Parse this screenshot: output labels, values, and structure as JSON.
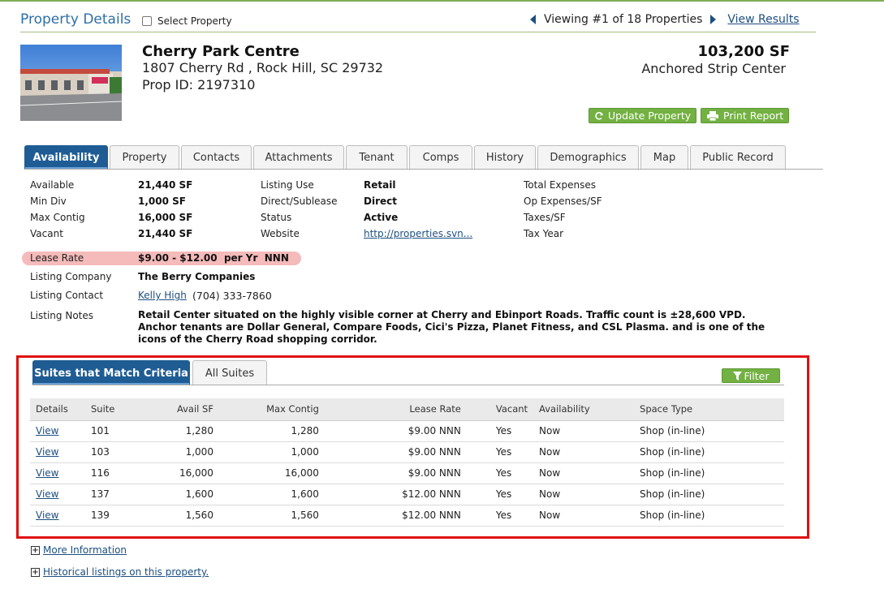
{
  "header": {
    "title": "Property Details",
    "select_label": "Select Property",
    "viewing": "Viewing #1 of 18 Properties",
    "view_results": "View Results"
  },
  "property": {
    "name": "Cherry Park Centre",
    "address": "1807 Cherry Rd , Rock Hill, SC 29732",
    "prop_id": "Prop ID:  2197310",
    "size": "103,200 SF",
    "type": "Anchored Strip Center",
    "update_btn": "Update Property",
    "print_btn": "Print Report"
  },
  "tabs": [
    "Availability",
    "Property",
    "Contacts",
    "Attachments",
    "Tenant",
    "Comps",
    "History",
    "Demographics",
    "Map",
    "Public Record"
  ],
  "details": {
    "col1": [
      {
        "label": "Available",
        "value": "21,440 SF"
      },
      {
        "label": "Min Div",
        "value": "1,000 SF"
      },
      {
        "label": "Max Contig",
        "value": "16,000 SF"
      },
      {
        "label": "Vacant",
        "value": "21,440 SF"
      }
    ],
    "col2": [
      {
        "label": "Listing Use",
        "value": "Retail"
      },
      {
        "label": "Direct/Sublease",
        "value": "Direct"
      },
      {
        "label": "Status",
        "value": "Active"
      },
      {
        "label": "Website",
        "value": "http://properties.svn..."
      }
    ],
    "col3": [
      {
        "label": "Total Expenses"
      },
      {
        "label": "Op Expenses/SF"
      },
      {
        "label": "Taxes/SF"
      },
      {
        "label": "Tax Year"
      }
    ],
    "lease_rate_label": "Lease Rate",
    "lease_rate_value": "$9.00 - $12.00  per Yr  NNN",
    "listing_company_label": "Listing Company",
    "listing_company_value": "The Berry Companies",
    "listing_contact_label": "Listing Contact",
    "listing_contact_name": "Kelly High",
    "listing_contact_phone": "(704) 333-7860",
    "listing_notes_label": "Listing Notes",
    "listing_notes": "Retail Center situated on the highly visible corner at Cherry and Ebinport Roads. Traffic count is ±28,600 VPD. Anchor tenants are Dollar General, Compare Foods, Cici's Pizza, Planet Fitness, and CSL Plasma. and is one of the icons of the Cherry Road shopping corridor."
  },
  "suites": {
    "tab_match": "Suites that Match Criteria",
    "tab_all": "All Suites",
    "filter": "Filter",
    "columns": [
      "Details",
      "Suite",
      "Avail SF",
      "Max Contig",
      "Lease Rate",
      "Vacant",
      "Availability",
      "Space Type"
    ],
    "rows": [
      {
        "details": "View",
        "suite": "101",
        "avail": "1,280",
        "max": "1,280",
        "rate": "$9.00 NNN",
        "vacant": "Yes",
        "availability": "Now",
        "type": "Shop (in-line)"
      },
      {
        "details": "View",
        "suite": "103",
        "avail": "1,000",
        "max": "1,000",
        "rate": "$9.00 NNN",
        "vacant": "Yes",
        "availability": "Now",
        "type": "Shop (in-line)"
      },
      {
        "details": "View",
        "suite": "116",
        "avail": "16,000",
        "max": "16,000",
        "rate": "$9.00 NNN",
        "vacant": "Yes",
        "availability": "Now",
        "type": "Shop (in-line)"
      },
      {
        "details": "View",
        "suite": "137",
        "avail": "1,600",
        "max": "1,600",
        "rate": "$12.00 NNN",
        "vacant": "Yes",
        "availability": "Now",
        "type": "Shop (in-line)"
      },
      {
        "details": "View",
        "suite": "139",
        "avail": "1,560",
        "max": "1,560",
        "rate": "$12.00 NNN",
        "vacant": "Yes",
        "availability": "Now",
        "type": "Shop (in-line)"
      }
    ]
  },
  "footer": {
    "more_info": "More Information",
    "historical": "Historical listings on this property."
  },
  "colors": {
    "brand_blue": "#2d6ea6",
    "active_tab": "#1f5c94",
    "button_green": "#73b142",
    "highlight": "#f4b3b3",
    "callout_red": "#e01010"
  },
  "icons": {
    "update": "refresh-icon",
    "print": "printer-icon",
    "filter": "funnel-icon",
    "prev": "triangle-left-icon",
    "next": "triangle-right-icon",
    "expand": "plus-box-icon"
  }
}
